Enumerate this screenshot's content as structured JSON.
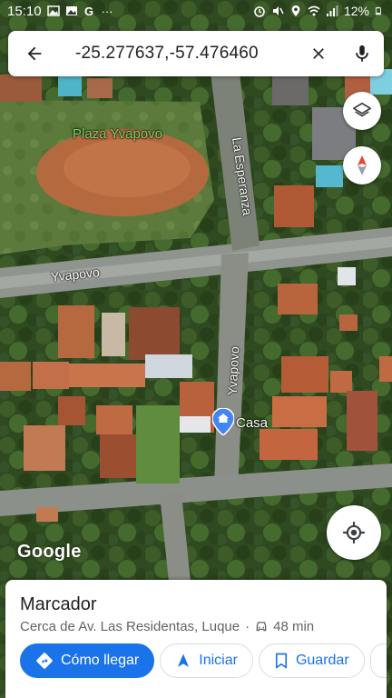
{
  "status_bar": {
    "time": "15:10",
    "more": "···",
    "battery": "12%"
  },
  "search": {
    "query": "-25.277637,-57.476460",
    "back_icon": "arrow-back-icon",
    "close_icon": "close-icon",
    "mic_icon": "mic-icon"
  },
  "map": {
    "plaza_label": "Plaza Yvapovo",
    "street_esperanza": "La Esperanza",
    "street_yvapovo_h": "Yvapovo",
    "street_yvapovo_v": "Yvapovo",
    "pin_label": "Casa",
    "pin_color": "#4285f4",
    "google_logo": "Google",
    "label_color_green": "#7ad26a"
  },
  "sheet": {
    "title": "Marcador",
    "subtitle": "Cerca de Av. Las Residentas, Luque",
    "drive_time": "48 min",
    "actions": [
      {
        "label": "Cómo llegar",
        "icon": "directions-icon"
      },
      {
        "label": "Iniciar",
        "icon": "navigation-arrow-icon"
      },
      {
        "label": "Guardar",
        "icon": "bookmark-icon"
      }
    ],
    "accent": "#1a73e8"
  }
}
